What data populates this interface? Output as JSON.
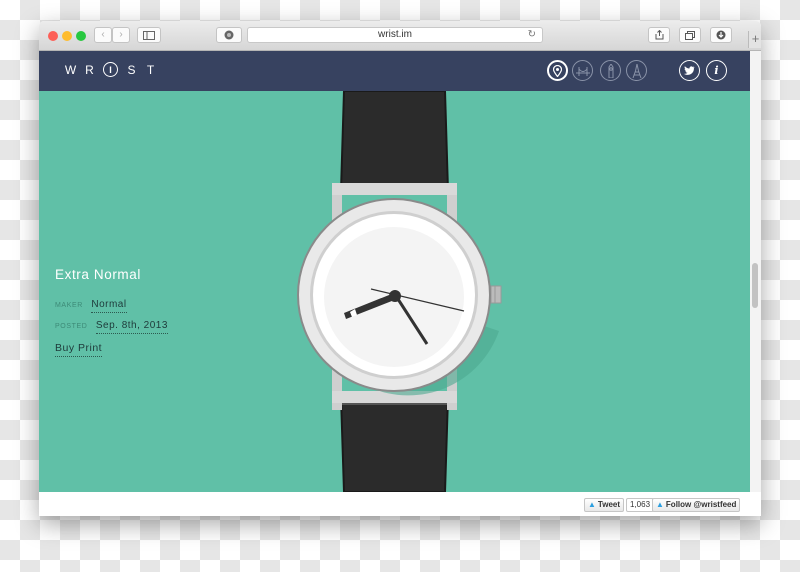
{
  "browser": {
    "url": "wrist.im",
    "back_glyph": "‹",
    "forward_glyph": "›",
    "reload_glyph": "↻",
    "new_tab_glyph": "+",
    "traffic_lights": [
      "#fd5f57",
      "#febc2e",
      "#28c840"
    ]
  },
  "site": {
    "logo_left": [
      "W",
      "R"
    ],
    "logo_center": "I",
    "logo_right": [
      "S",
      "T"
    ],
    "nav_icons": [
      "map-pin-icon",
      "bridge-icon",
      "big-ben-icon",
      "eiffel-tower-icon"
    ],
    "social_icons": [
      "twitter-icon",
      "info-icon"
    ],
    "info_glyph": "i"
  },
  "watch": {
    "title": "Extra Normal",
    "maker_label": "MAKER",
    "maker": "Normal",
    "posted_label": "POSTED",
    "posted": "Sep. 8th, 2013",
    "buy_label": "Buy Print",
    "background_color": "#60c0a7"
  },
  "footer": {
    "tweet_label": "Tweet",
    "tweet_count": "1,063",
    "follow_label": "Follow @wristfeed"
  }
}
